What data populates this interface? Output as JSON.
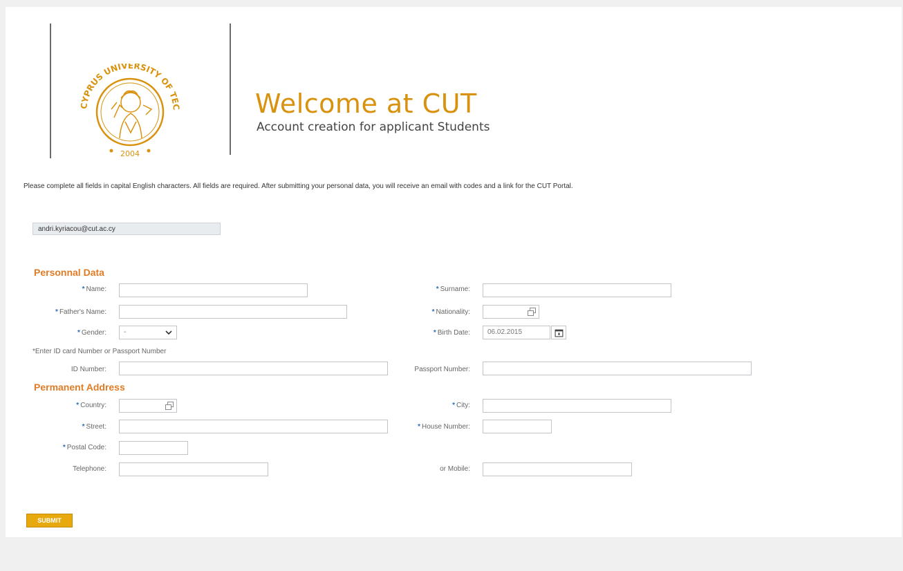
{
  "header": {
    "title": "Welcome at CUT",
    "subtitle": "Account creation for applicant Students",
    "logo": {
      "ring_text": "CYPRUS UNIVERSITY OF TECHNOLOGY",
      "year": "2004",
      "color": "#d8920e"
    }
  },
  "instructions": "Please complete all fields in capital English characters.  All fields are required. After submitting your personal data, you will receive an email with codes and a link for the CUT Portal.",
  "email": "andri.kyriacou@cut.ac.cy",
  "personal": {
    "section_title": "Personnal Data",
    "name_label": "Name:",
    "surname_label": "Surname:",
    "fathers_name_label": "Father's Name:",
    "nationality_label": "Nationality:",
    "gender_label": "Gender:",
    "gender_value": "-",
    "birth_date_label": "Birth Date:",
    "birth_date_value": "06.02.2015",
    "id_hint": "*Enter ID card Number or Passport Number",
    "id_number_label": "ID Number:",
    "passport_number_label": "Passport Number:"
  },
  "address": {
    "section_title": "Permanent Address",
    "country_label": "Country:",
    "city_label": "City:",
    "street_label": "Street:",
    "house_number_label": "House Number:",
    "postal_code_label": "Postal Code:",
    "telephone_label": "Telephone:",
    "mobile_label": "or Mobile:"
  },
  "submit_label": "SUBMIT",
  "colors": {
    "accent": "#d8920e",
    "section": "#e07b26",
    "required_marker": "#2d6fb7",
    "submit_bg": "#e8a90f"
  }
}
